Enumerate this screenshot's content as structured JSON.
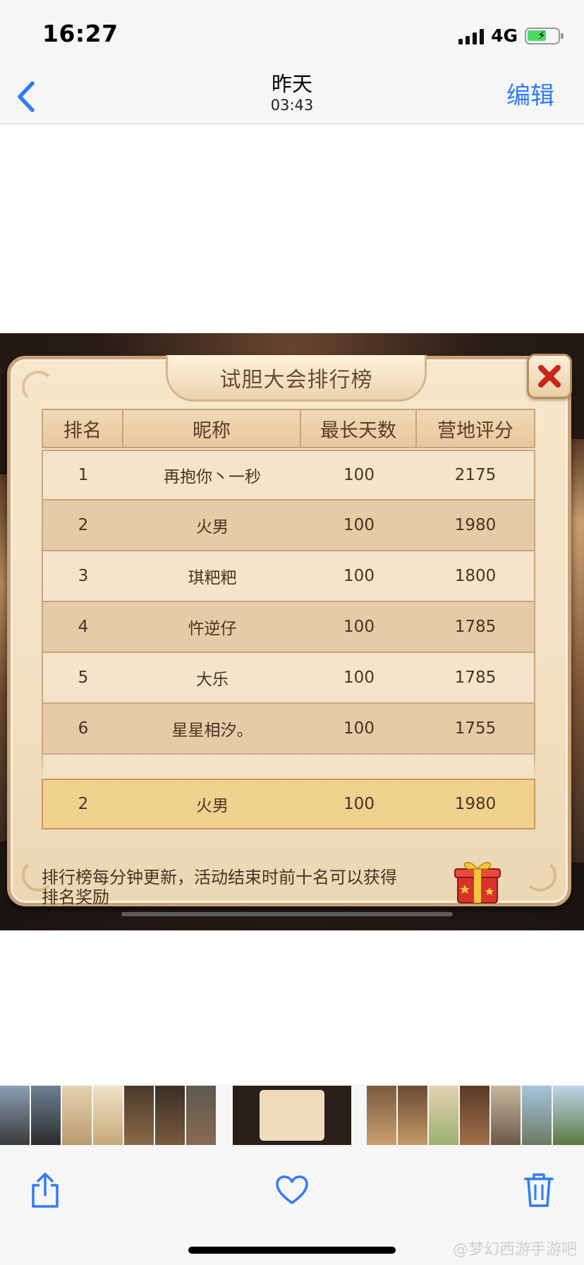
{
  "status_bar": {
    "time": "16:27",
    "network": "4G"
  },
  "nav": {
    "title": "昨天",
    "subtitle": "03:43",
    "edit_label": "编辑"
  },
  "panel": {
    "title": "试胆大会排行榜",
    "headers": [
      "排名",
      "昵称",
      "最长天数",
      "营地评分"
    ],
    "rows": [
      {
        "rank": "1",
        "name": "再抱你丶一秒",
        "days": "100",
        "score": "2175"
      },
      {
        "rank": "2",
        "name": "火男",
        "days": "100",
        "score": "1980"
      },
      {
        "rank": "3",
        "name": "琪粑粑",
        "days": "100",
        "score": "1800"
      },
      {
        "rank": "4",
        "name": "忤逆仔",
        "days": "100",
        "score": "1785"
      },
      {
        "rank": "5",
        "name": "大乐",
        "days": "100",
        "score": "1785"
      },
      {
        "rank": "6",
        "name": "星星相汐。",
        "days": "100",
        "score": "1755"
      }
    ],
    "my_row": {
      "rank": "2",
      "name": "火男",
      "days": "100",
      "score": "1980"
    },
    "note": "排行榜每分钟更新，活动结束时前十名可以获得排名奖励"
  },
  "toolbar": {
    "share_icon": "share-icon",
    "favorite_icon": "heart-icon",
    "delete_icon": "trash-icon"
  },
  "watermark": "@梦幻西游手游吧",
  "colors": {
    "accent": "#2f7cf6",
    "panel_bg": "#f2e0c1",
    "highlight_row": "#f0d28e"
  }
}
